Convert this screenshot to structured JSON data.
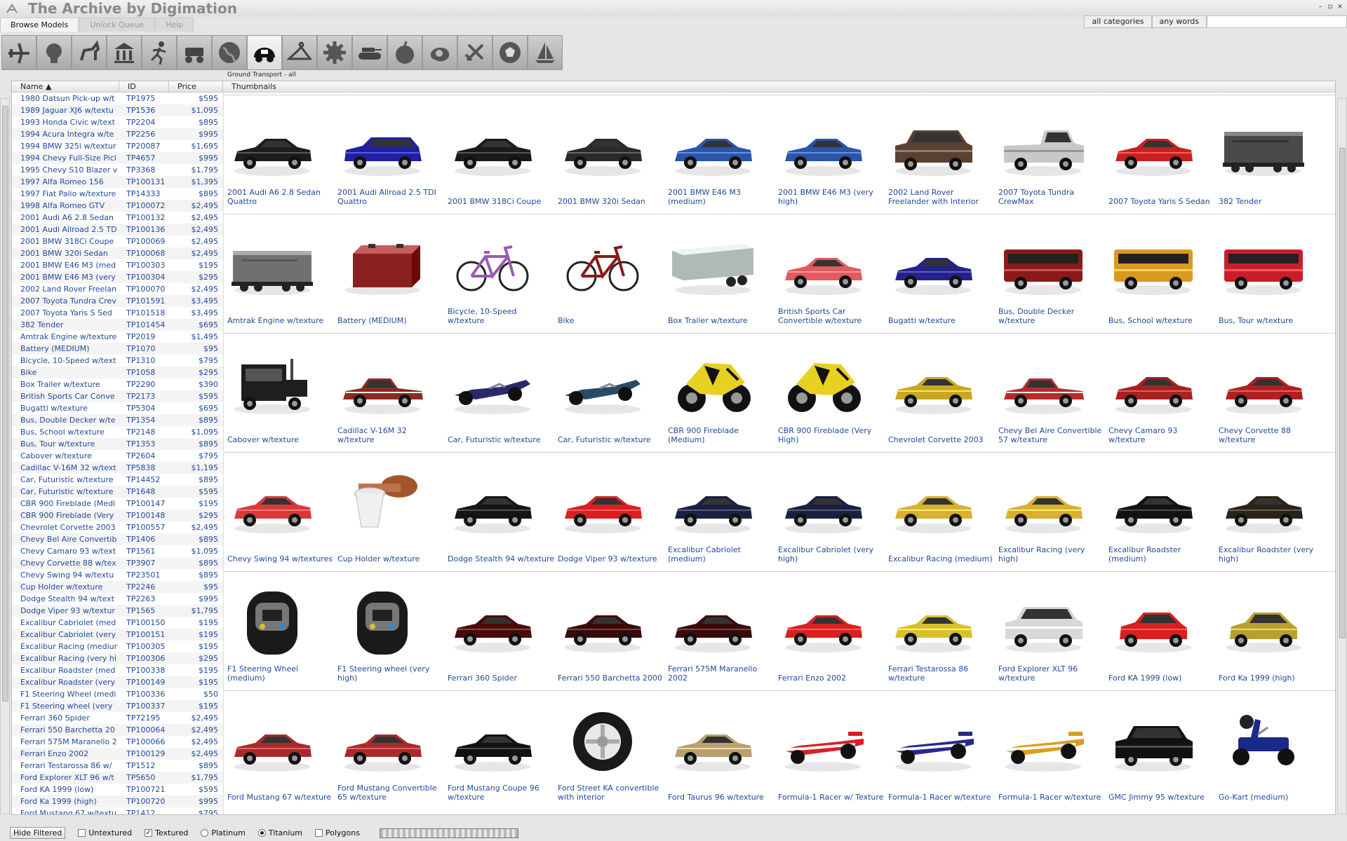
{
  "app": {
    "title": "The Archive by Digimation"
  },
  "tabs": [
    "Browse Models",
    "Unlock Queue",
    "Help"
  ],
  "search": {
    "category": "all categories",
    "mode": "any words",
    "value": ""
  },
  "categories": {
    "icons": [
      "airplane-icon",
      "head-icon",
      "horse-icon",
      "building-icon",
      "runner-icon",
      "machinery-icon",
      "globe-icon",
      "car-icon",
      "hanger-icon",
      "gear-icon",
      "tank-icon",
      "fruit-icon",
      "blob-icon",
      "tools-icon",
      "soccer-ball-icon",
      "sailboat-icon"
    ],
    "active_caption": "Ground Transport - all"
  },
  "columns": {
    "name": "Name",
    "id": "ID",
    "price": "Price",
    "thumbs": "Thumbnails"
  },
  "list": [
    {
      "name": "1980 Datsun Pick-up w/t",
      "id": "TP1975",
      "price": "$595"
    },
    {
      "name": "1989 Jaguar XJ6 w/textu",
      "id": "TP1536",
      "price": "$1,095"
    },
    {
      "name": "1993 Honda Civic w/text",
      "id": "TP2204",
      "price": "$895"
    },
    {
      "name": "1994 Acura Integra w/te",
      "id": "TP2256",
      "price": "$995"
    },
    {
      "name": "1994 BMW 325i w/textur",
      "id": "TP20087",
      "price": "$1,695"
    },
    {
      "name": "1994 Chevy Full-Size Picl",
      "id": "TP4657",
      "price": "$995"
    },
    {
      "name": "1995 Chevy S10 Blazer v",
      "id": "TP3368",
      "price": "$1,795"
    },
    {
      "name": "1997 Alfa Romeo 156",
      "id": "TP100131",
      "price": "$1,395"
    },
    {
      "name": "1997 Fiat Palio w/texture",
      "id": "TP14333",
      "price": "$895"
    },
    {
      "name": "1998 Alfa Romeo GTV",
      "id": "TP100072",
      "price": "$2,495"
    },
    {
      "name": "2001 Audi A6 2.8 Sedan",
      "id": "TP100132",
      "price": "$2,495"
    },
    {
      "name": "2001 Audi Allroad 2.5 TD",
      "id": "TP100136",
      "price": "$2,495"
    },
    {
      "name": "2001 BMW 318Ci Coupe",
      "id": "TP100069",
      "price": "$2,495"
    },
    {
      "name": "2001 BMW 320i Sedan",
      "id": "TP100068",
      "price": "$2,495"
    },
    {
      "name": "2001 BMW E46 M3 (med",
      "id": "TP100303",
      "price": "$195"
    },
    {
      "name": "2001 BMW E46 M3 (very",
      "id": "TP100304",
      "price": "$295"
    },
    {
      "name": "2002 Land Rover Freelan",
      "id": "TP100070",
      "price": "$2,495"
    },
    {
      "name": "2007 Toyota Tundra Crev",
      "id": "TP101591",
      "price": "$3,495"
    },
    {
      "name": "2007 Toyota Yaris S Sed",
      "id": "TP101518",
      "price": "$3,495"
    },
    {
      "name": "382 Tender",
      "id": "TP101454",
      "price": "$695"
    },
    {
      "name": "Amtrak Engine w/texture",
      "id": "TP2019",
      "price": "$1,495"
    },
    {
      "name": "Battery (MEDIUM)",
      "id": "TP1070",
      "price": "$95"
    },
    {
      "name": "Bicycle, 10-Speed w/text",
      "id": "TP1310",
      "price": "$795"
    },
    {
      "name": "Bike",
      "id": "TP1058",
      "price": "$295"
    },
    {
      "name": "Box Trailer w/texture",
      "id": "TP2290",
      "price": "$390"
    },
    {
      "name": "British Sports Car Conve",
      "id": "TP2173",
      "price": "$595"
    },
    {
      "name": "Bugatti w/texture",
      "id": "TP5304",
      "price": "$695"
    },
    {
      "name": "Bus, Double Decker w/te",
      "id": "TP1354",
      "price": "$895"
    },
    {
      "name": "Bus, School w/texture",
      "id": "TP2148",
      "price": "$1,095"
    },
    {
      "name": "Bus, Tour w/texture",
      "id": "TP1353",
      "price": "$895"
    },
    {
      "name": "Cabover w/texture",
      "id": "TP2604",
      "price": "$795"
    },
    {
      "name": "Cadillac V-16M 32 w/text",
      "id": "TP5838",
      "price": "$1,195"
    },
    {
      "name": "Car, Futuristic w/texture",
      "id": "TP14452",
      "price": "$895"
    },
    {
      "name": "Car, Futuristic w/texture",
      "id": "TP1648",
      "price": "$595"
    },
    {
      "name": "CBR 900 Fireblade (Medi",
      "id": "TP100147",
      "price": "$195"
    },
    {
      "name": "CBR 900 Fireblade (Very",
      "id": "TP100148",
      "price": "$295"
    },
    {
      "name": "Chevrolet Corvette 2003",
      "id": "TP100557",
      "price": "$2,495"
    },
    {
      "name": "Chevy Bel Aire Convertib",
      "id": "TP1406",
      "price": "$895"
    },
    {
      "name": "Chevy Camaro 93 w/text",
      "id": "TP1561",
      "price": "$1,095"
    },
    {
      "name": "Chevy Corvette 88 w/tex",
      "id": "TP3907",
      "price": "$895"
    },
    {
      "name": "Chevy Swing 94 w/textu",
      "id": "TP23501",
      "price": "$895"
    },
    {
      "name": "Cup Holder w/texture",
      "id": "TP2246",
      "price": "$95"
    },
    {
      "name": "Dodge Stealth 94 w/text",
      "id": "TP2263",
      "price": "$995"
    },
    {
      "name": "Dodge Viper 93 w/textur",
      "id": "TP1565",
      "price": "$1,795"
    },
    {
      "name": "Excalibur Cabriolet (med",
      "id": "TP100150",
      "price": "$195"
    },
    {
      "name": "Excalibur Cabriolet (very",
      "id": "TP100151",
      "price": "$195"
    },
    {
      "name": "Excalibur Racing (mediur",
      "id": "TP100305",
      "price": "$195"
    },
    {
      "name": "Excalibur Racing (very hi",
      "id": "TP100306",
      "price": "$295"
    },
    {
      "name": "Excalibur Roadster (med",
      "id": "TP100338",
      "price": "$195"
    },
    {
      "name": "Excalibur Roadster (very",
      "id": "TP100149",
      "price": "$195"
    },
    {
      "name": "F1 Steering Wheel (medi",
      "id": "TP100336",
      "price": "$50"
    },
    {
      "name": "F1 Steering wheel (very",
      "id": "TP100337",
      "price": "$195"
    },
    {
      "name": "Ferrari 360 Spider",
      "id": "TP72195",
      "price": "$2,495"
    },
    {
      "name": "Ferrari 550 Barchetta 20",
      "id": "TP100064",
      "price": "$2,495"
    },
    {
      "name": "Ferrari 575M Maranello 2",
      "id": "TP100066",
      "price": "$2,495"
    },
    {
      "name": "Ferrari Enzo 2002",
      "id": "TP100129",
      "price": "$2,495"
    },
    {
      "name": "Ferrari Testarossa 86 w/",
      "id": "TP1512",
      "price": "$895"
    },
    {
      "name": "Ford Explorer XLT 96 w/t",
      "id": "TP5650",
      "price": "$1,795"
    },
    {
      "name": "Ford KA  1999 (low)",
      "id": "TP100721",
      "price": "$595"
    },
    {
      "name": "Ford Ka 1999 (high)",
      "id": "TP100720",
      "price": "$995"
    },
    {
      "name": "Ford Mustang 67 w/textu",
      "id": "TP1412",
      "price": "$795"
    }
  ],
  "thumbnails": [
    [
      {
        "label": "2001 Audi A6 2.8 Sedan Quattro",
        "kind": "car",
        "color": "#1c1c1c"
      },
      {
        "label": "2001 Audi Allroad 2.5 TDI Quattro",
        "kind": "wagon",
        "color": "#1f1fa0"
      },
      {
        "label": "2001 BMW 318Ci Coupe",
        "kind": "car",
        "color": "#1a1a1a"
      },
      {
        "label": "2001 BMW 320i Sedan",
        "kind": "car",
        "color": "#2a2a2a"
      },
      {
        "label": "2001 BMW E46 M3 (medium)",
        "kind": "car",
        "color": "#2a55a8"
      },
      {
        "label": "2001 BMW E46 M3 (very high)",
        "kind": "car",
        "color": "#2a55a8"
      },
      {
        "label": "2002 Land Rover Freelander with Interior",
        "kind": "suv",
        "color": "#5a4030"
      },
      {
        "label": "2007 Toyota Tundra CrewMax",
        "kind": "pickup",
        "color": "#c8c8c8"
      },
      {
        "label": "2007 Toyota Yaris S Sedan",
        "kind": "car",
        "color": "#c82020"
      },
      {
        "label": "382 Tender",
        "kind": "train",
        "color": "#4a4a4a"
      }
    ],
    [
      {
        "label": "Amtrak Engine w/texture",
        "kind": "train",
        "color": "#707070"
      },
      {
        "label": "Battery (MEDIUM)",
        "kind": "battery",
        "color": "#8a2020"
      },
      {
        "label": "Bicycle, 10-Speed w/texture",
        "kind": "bike",
        "color": "#9a5ab0"
      },
      {
        "label": "Bike",
        "kind": "bike",
        "color": "#8a1a1a"
      },
      {
        "label": "Box Trailer w/texture",
        "kind": "trailer",
        "color": "#b0b8b8"
      },
      {
        "label": "British Sports Car Convertible w/texture",
        "kind": "car",
        "color": "#e05a60"
      },
      {
        "label": "Bugatti w/texture",
        "kind": "car",
        "color": "#22228a"
      },
      {
        "label": "Bus, Double Decker w/texture",
        "kind": "bus",
        "color": "#8a1a1a"
      },
      {
        "label": "Bus, School w/texture",
        "kind": "bus",
        "color": "#d89a20"
      },
      {
        "label": "Bus, Tour w/texture",
        "kind": "bus",
        "color": "#c81e2a"
      }
    ],
    [
      {
        "label": "Cabover w/texture",
        "kind": "truck",
        "color": "#1e1e1e"
      },
      {
        "label": "Cadillac V-16M 32 w/texture",
        "kind": "classic",
        "color": "#8a2a20"
      },
      {
        "label": "Car, Futuristic w/texture",
        "kind": "racer",
        "color": "#2a2a6a"
      },
      {
        "label": "Car, Futuristic w/texture",
        "kind": "racer",
        "color": "#2a4a6a"
      },
      {
        "label": "CBR 900 Fireblade (Medium)",
        "kind": "moto",
        "color": "#e8d020"
      },
      {
        "label": "CBR 900 Fireblade (Very High)",
        "kind": "moto",
        "color": "#e8d020"
      },
      {
        "label": "Chevrolet Corvette 2003",
        "kind": "car",
        "color": "#c8a820"
      },
      {
        "label": "Chevy Bel Aire Convertible 57 w/texture",
        "kind": "classic",
        "color": "#b82a2a"
      },
      {
        "label": "Chevy Camaro 93 w/texture",
        "kind": "car",
        "color": "#a82020"
      },
      {
        "label": "Chevy Corvette 88 w/texture",
        "kind": "car",
        "color": "#b02020"
      }
    ],
    [
      {
        "label": "Chevy Swing 94 w/textures",
        "kind": "car",
        "color": "#d83a3a"
      },
      {
        "label": "Cup Holder w/texture",
        "kind": "cup",
        "color": "#a0562a"
      },
      {
        "label": "Dodge Stealth 94 w/texture",
        "kind": "car",
        "color": "#151515"
      },
      {
        "label": "Dodge Viper 93 w/texture",
        "kind": "car",
        "color": "#d82020"
      },
      {
        "label": "Excalibur Cabriolet (medium)",
        "kind": "car",
        "color": "#1a2040"
      },
      {
        "label": "Excalibur Cabriolet (very high)",
        "kind": "car",
        "color": "#1a2040"
      },
      {
        "label": "Excalibur Racing (medium)",
        "kind": "car",
        "color": "#d8b030"
      },
      {
        "label": "Excalibur Racing (very high)",
        "kind": "car",
        "color": "#d8b030"
      },
      {
        "label": "Excalibur Roadster (medium)",
        "kind": "car",
        "color": "#121212"
      },
      {
        "label": "Excalibur Roadster (very high)",
        "kind": "car",
        "color": "#2a2418"
      }
    ],
    [
      {
        "label": "F1 Steering Wheel (medium)",
        "kind": "wheel",
        "color": "#1a1a1a"
      },
      {
        "label": "F1 Steering wheel (very high)",
        "kind": "wheel",
        "color": "#1a1a1a"
      },
      {
        "label": "Ferrari 360 Spider",
        "kind": "car",
        "color": "#4a0a0a"
      },
      {
        "label": "Ferrari 550 Barchetta 2000",
        "kind": "car",
        "color": "#3a0a0a"
      },
      {
        "label": "Ferrari 575M Maranello 2002",
        "kind": "car",
        "color": "#3a0a0a"
      },
      {
        "label": "Ferrari Enzo 2002",
        "kind": "car",
        "color": "#d82020"
      },
      {
        "label": "Ferrari Testarossa 86 w/texture",
        "kind": "car",
        "color": "#d8c030"
      },
      {
        "label": "Ford Explorer XLT 96 w/texture",
        "kind": "suv",
        "color": "#d8d8d8"
      },
      {
        "label": "Ford KA  1999 (low)",
        "kind": "hatch",
        "color": "#d82020"
      },
      {
        "label": "Ford Ka 1999 (high)",
        "kind": "hatch",
        "color": "#b8a030"
      }
    ],
    [
      {
        "label": "Ford Mustang 67 w/texture",
        "kind": "car",
        "color": "#a82a2a"
      },
      {
        "label": "Ford Mustang Convertible 65 w/texture",
        "kind": "car",
        "color": "#a82a2a"
      },
      {
        "label": "Ford Mustang Coupe 96 w/texture",
        "kind": "car",
        "color": "#111111"
      },
      {
        "label": "Ford Street KA convertible with interior",
        "kind": "tire",
        "color": "#1a1a1a"
      },
      {
        "label": "Ford Taurus 96 w/texture",
        "kind": "car",
        "color": "#b8a070"
      },
      {
        "label": "Formula-1 Racer w/ Texture",
        "kind": "f1",
        "color": "#d82020"
      },
      {
        "label": "Formula-1 Racer w/texture",
        "kind": "f1",
        "color": "#2a2a8a"
      },
      {
        "label": "Formula-1 Racer w/texture",
        "kind": "f1",
        "color": "#d8a020"
      },
      {
        "label": "GMC Jimmy 95 w/texture",
        "kind": "suv",
        "color": "#111111"
      },
      {
        "label": "Go-Kart (medium)",
        "kind": "kart",
        "color": "#1a2a8a"
      }
    ]
  ],
  "statusbar": {
    "hide_filtered": "Hide Filtered",
    "untextured": "Untextured",
    "textured": "Textured",
    "platinum": "Platinum",
    "titanium": "Titanium",
    "polygons": "Polygons"
  }
}
